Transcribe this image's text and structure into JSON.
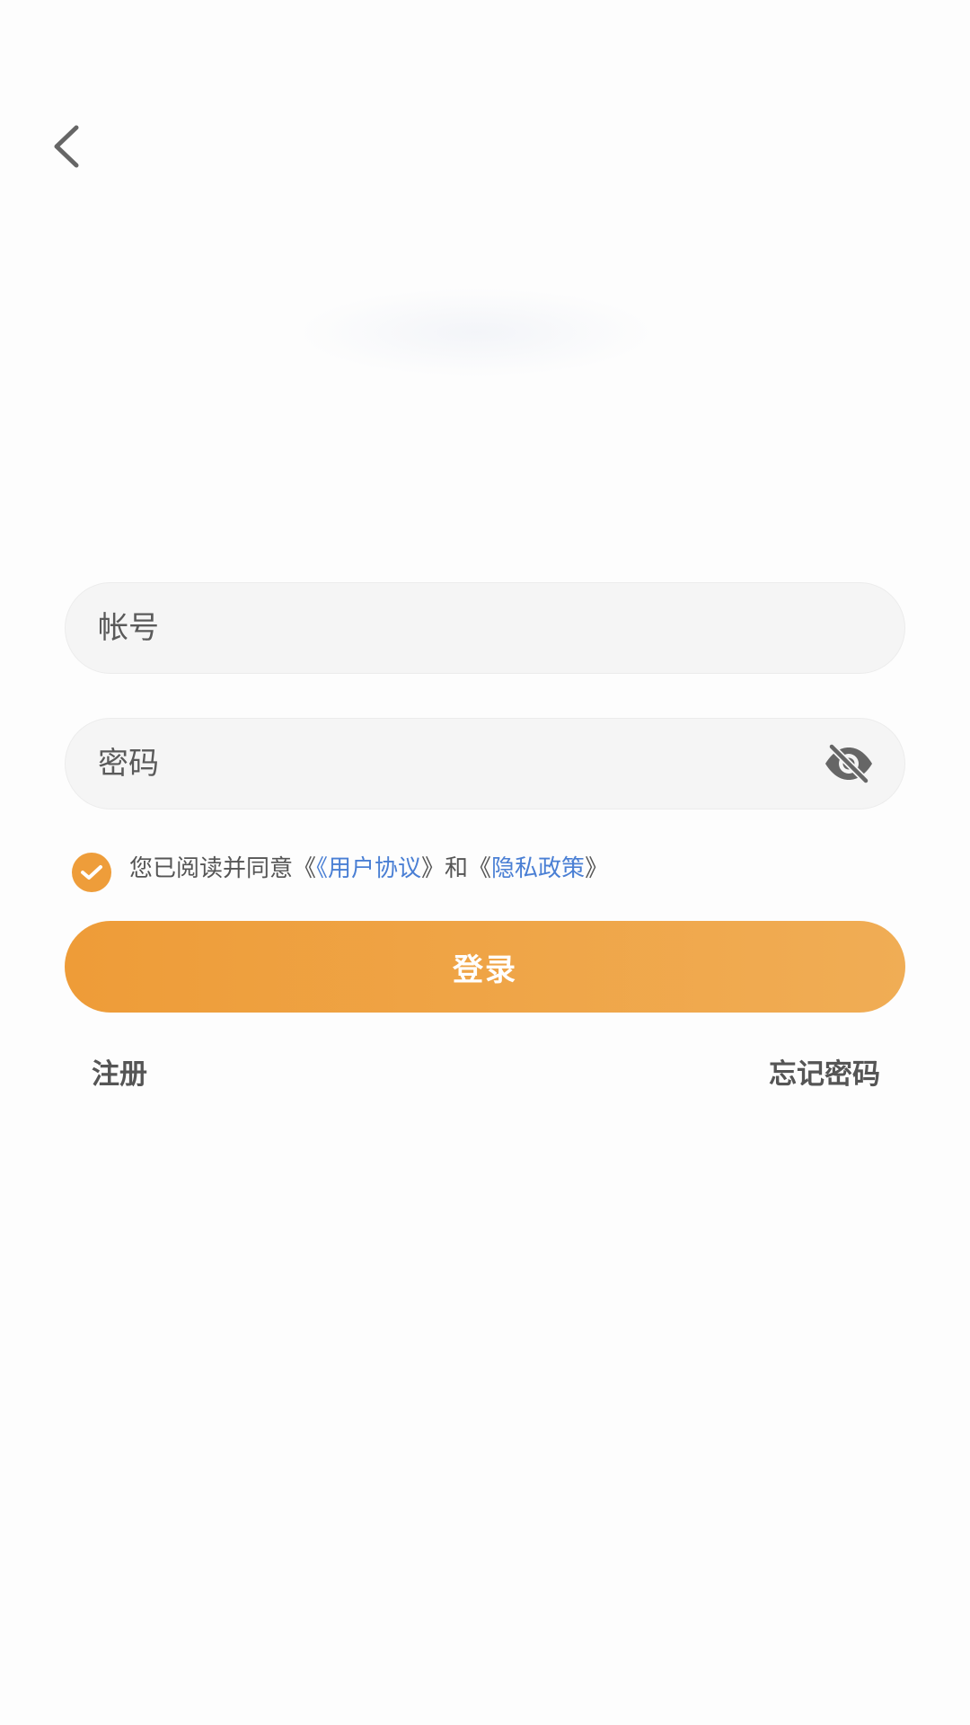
{
  "nav": {
    "back_icon": "chevron-left-icon"
  },
  "form": {
    "account_placeholder": "帐号",
    "password_placeholder": "密码",
    "password_toggle_icon": "eye-off-icon"
  },
  "agreement": {
    "checked": true,
    "prefix": "您已阅读并同意《",
    "user_agreement_link": "《用户协议",
    "middle": "》和《",
    "privacy_link": "隐私政策",
    "suffix": "》"
  },
  "actions": {
    "login_label": "登录",
    "register_label": "注册",
    "forgot_label": "忘记密码"
  },
  "colors": {
    "accent": "#ee9d3a",
    "link": "#4a7fd4"
  }
}
